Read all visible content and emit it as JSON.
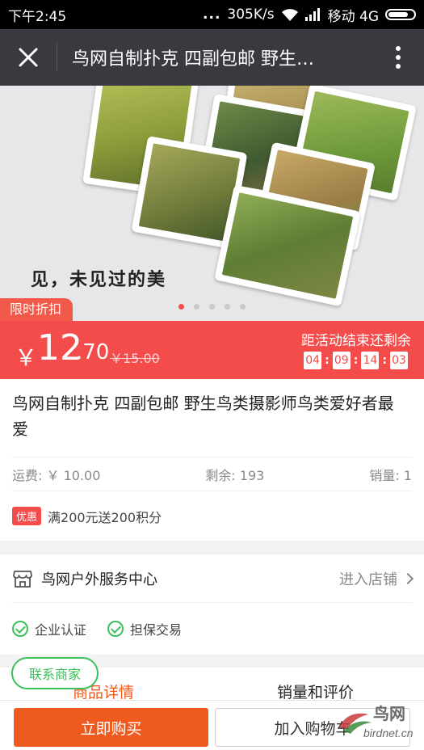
{
  "status_bar": {
    "time": "下午2:45",
    "dots": "...",
    "speed": "305K/s",
    "carrier": "移动 4G"
  },
  "header": {
    "title": "鸟网自制扑克 四副包邮 野生…",
    "close_icon": "close-icon",
    "more_icon": "more-vertical-icon"
  },
  "banner": {
    "caption": "见，未见过的美",
    "slide_count": 5,
    "active_slide": 1
  },
  "promotion": {
    "tag": "限时折扣",
    "currency": "￥",
    "price_integer": "12",
    "price_decimal": ".70",
    "original_price": "￥15.00",
    "countdown_label": "距活动结束还剩余",
    "countdown": [
      "04",
      "09",
      "14",
      "03"
    ]
  },
  "product": {
    "title": "鸟网自制扑克 四副包邮 野生鸟类摄影师鸟类爱好者最爱",
    "shipping": "运费: ￥ 10.00",
    "stock": "剩余: 193",
    "sales": "销量: 1",
    "promo_badge": "优惠",
    "promo_text": "满200元送200积分"
  },
  "shop": {
    "name": "鸟网户外服务中心",
    "enter_label": "进入店铺",
    "badges": [
      "企业认证",
      "担保交易"
    ]
  },
  "tabs": {
    "details": "商品详情",
    "reviews": "销量和评价",
    "contact": "联系商家"
  },
  "actions": {
    "buy_now": "立即购买",
    "add_to_cart": "加入购物车"
  },
  "watermark": {
    "name": "鸟网",
    "url": "birdnet.cn"
  },
  "colors": {
    "price_red": "#f44b4b",
    "accent_orange": "#ef5a1e",
    "check_green": "#3bbf5a",
    "header_dark": "#383a3f"
  }
}
